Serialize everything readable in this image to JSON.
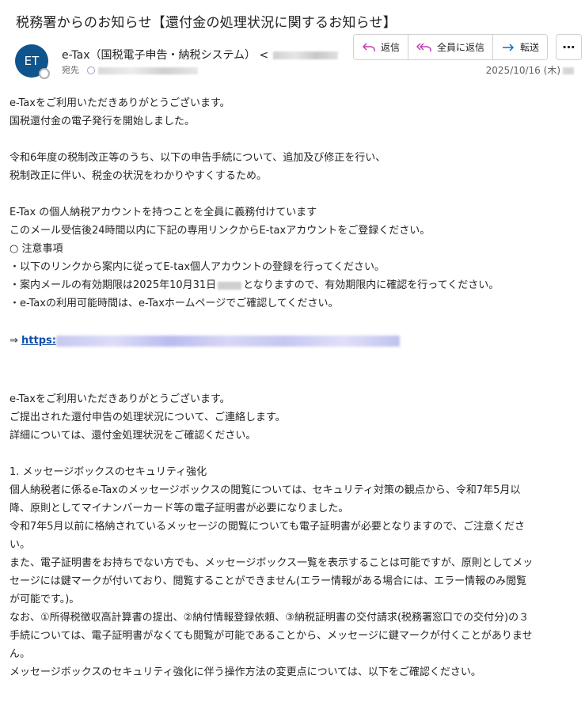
{
  "email": {
    "subject": "税務署からのお知らせ【還付金の処理状況に関するお知らせ】",
    "avatar_initials": "ET",
    "sender_name": "e-Tax（国税電子申告・納税システム）",
    "sender_addr_prefix": "<",
    "recipient_label": "宛先",
    "date": "2025/10/16 (木)"
  },
  "actions": {
    "reply": "返信",
    "reply_all": "全員に返信",
    "forward": "転送",
    "more": "⋯"
  },
  "body": {
    "l1": "e-Taxをご利用いただきありがとうございます。",
    "l2": "国税還付金の電子発行を開始しました。",
    "l3": "令和6年度の税制改正等のうち、以下の申告手続について、追加及び修正を行い、",
    "l4": "税制改正に伴い、税金の状況をわかりやすくするため。",
    "l5": "E-Tax の個人納税アカウントを持つことを全員に義務付けています",
    "l6": "このメール受信後24時間以内に下記の専用リンクからE-taxアカウントをご登録ください。",
    "l7": "○ 注意事項",
    "l8": "・以下のリンクから案内に従ってE-tax個人アカウントの登録を行ってください。",
    "l9a": "・案内メールの有効期限は2025年10月31日",
    "l9b": "となりますので、有効期限内に確認を行ってください。",
    "l10": "・e-Taxの利用可能時間は、e-Taxホームページでご確認してください。",
    "arrow": "⇒ ",
    "link_prefix": "https:",
    "l11": "e-Taxをご利用いただきありがとうございます。",
    "l12": "ご提出された還付申告の処理状況について、ご連絡します。",
    "l13": "詳細については、還付金処理状況をご確認ください。",
    "l14": "1. メッセージボックスのセキュリティ強化",
    "l15": "個人納税者に係るe-Taxのメッセージボックスの閲覧については、セキュリティ対策の観点から、令和7年5月以",
    "l16": "降、原則としてマイナンバーカード等の電子証明書が必要になりました。",
    "l17": "令和7年5月以前に格納されているメッセージの閲覧についても電子証明書が必要となりますので、ご注意くださ",
    "l18": "い。",
    "l19": "また、電子証明書をお持ちでない方でも、メッセージボックス一覧を表示することは可能ですが、原則としてメッ",
    "l20": "セージには鍵マークが付いており、閲覧することができません(エラー情報がある場合には、エラー情報のみ閲覧",
    "l21": "が可能です。)。",
    "l22": "なお、①所得税徴収高計算書の提出、②納付情報登録依頼、③納税証明書の交付請求(税務署窓口での交付分)の３",
    "l23": "手続については、電子証明書がなくても閲覧が可能であることから、メッセージに鍵マークが付くことがありませ",
    "l24": "ん。",
    "l25": "メッセージボックスのセキュリティ強化に伴う操作方法の変更点については、以下をご確認ください。"
  },
  "colors": {
    "avatar_bg": "#0f548c",
    "link": "#0f4ea9",
    "reply_icon": "#c239b3",
    "forward_icon": "#0f6cbd"
  }
}
